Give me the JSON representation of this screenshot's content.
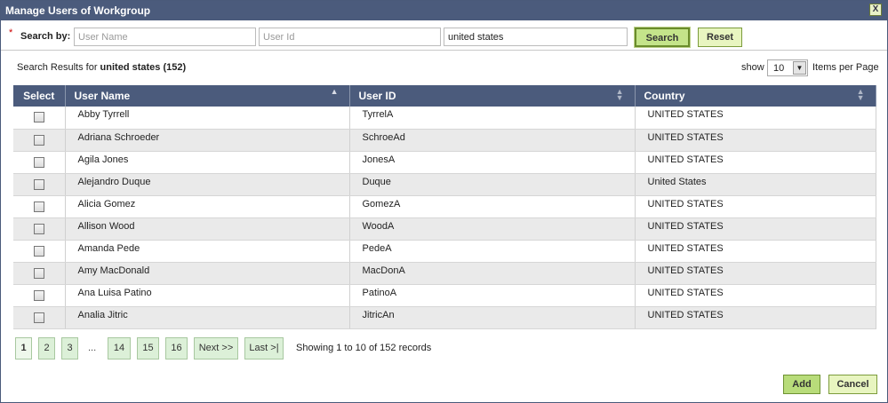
{
  "dialog": {
    "title": "Manage Users of Workgroup",
    "close_label": "X"
  },
  "search": {
    "required_mark": "*",
    "label": "Search by:",
    "username_placeholder": "User Name",
    "userid_placeholder": "User Id",
    "country_value": "united states",
    "search_label": "Search",
    "reset_label": "Reset"
  },
  "results": {
    "prefix": "Search Results for",
    "query": "united states",
    "count": "(152)",
    "show_label": "show",
    "per_page": "10",
    "per_page_suffix": "Items per Page"
  },
  "table": {
    "columns": [
      "Select",
      "User Name",
      "User ID",
      "Country"
    ],
    "rows": [
      {
        "name": "Abby Tyrrell",
        "id": "TyrrelA",
        "country": "UNITED STATES"
      },
      {
        "name": "Adriana Schroeder",
        "id": "SchroeAd",
        "country": "UNITED STATES"
      },
      {
        "name": "Agila Jones",
        "id": "JonesA",
        "country": "UNITED STATES"
      },
      {
        "name": "Alejandro Duque",
        "id": "Duque",
        "country": "United States"
      },
      {
        "name": "Alicia Gomez",
        "id": "GomezA",
        "country": "UNITED STATES"
      },
      {
        "name": "Allison Wood",
        "id": "WoodA",
        "country": "UNITED STATES"
      },
      {
        "name": "Amanda Pede",
        "id": "PedeA",
        "country": "UNITED STATES"
      },
      {
        "name": "Amy MacDonald",
        "id": "MacDonA",
        "country": "UNITED STATES"
      },
      {
        "name": "Ana Luisa Patino",
        "id": "PatinoA",
        "country": "UNITED STATES"
      },
      {
        "name": "Analia Jitric",
        "id": "JitricAn",
        "country": "UNITED STATES"
      }
    ]
  },
  "pagination": {
    "pages": [
      "1",
      "2",
      "3"
    ],
    "ellipsis": "...",
    "last_pages": [
      "14",
      "15",
      "16"
    ],
    "next_label": "Next >>",
    "last_label": "Last >|",
    "summary": "Showing 1 to 10 of 152 records"
  },
  "footer": {
    "add_label": "Add",
    "cancel_label": "Cancel"
  },
  "colors": {
    "header_bg": "#4b5b7c",
    "button_green": "#c4e48a",
    "pager_green": "#dcf0d8"
  }
}
